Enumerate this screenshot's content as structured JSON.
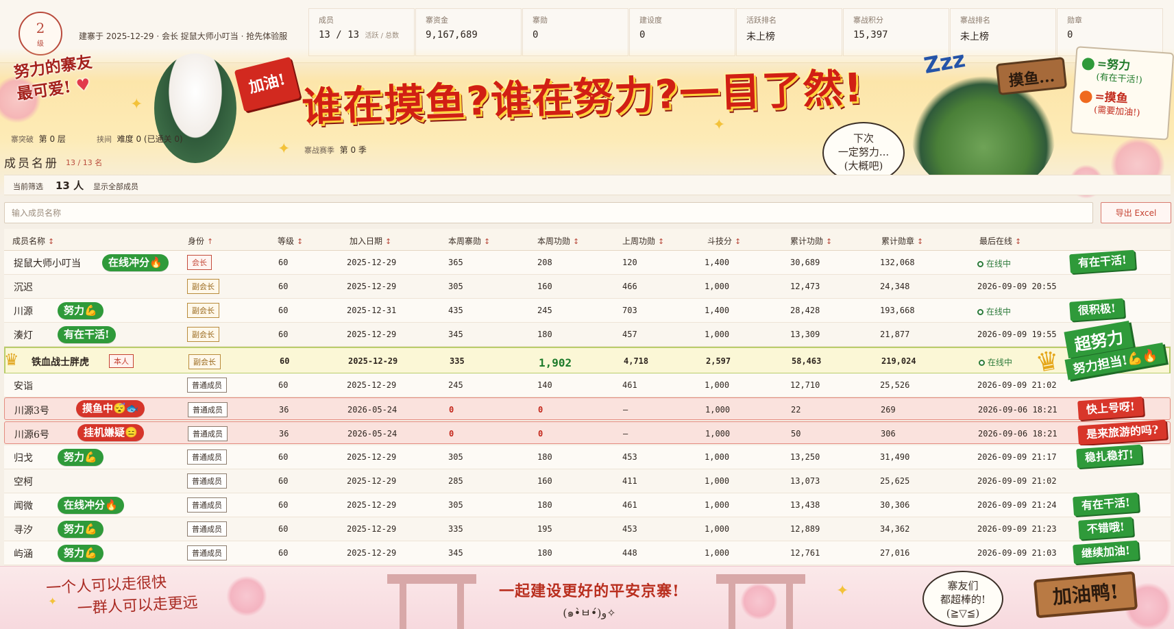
{
  "header": {
    "level": "2",
    "level_unit": "级",
    "founded": "建寨于 2025-12-29 · 会长 捉鼠大师小叮当 · 抢先体验服",
    "stats": [
      {
        "label": "成员",
        "value": "13 / 13",
        "sub": "活跃 / 总数"
      },
      {
        "label": "寨资金",
        "value": "9,167,689"
      },
      {
        "label": "寨勋",
        "value": "0"
      },
      {
        "label": "建设度",
        "value": "0"
      },
      {
        "label": "活跃排名",
        "value": "未上榜"
      },
      {
        "label": "寨战积分",
        "value": "15,397"
      },
      {
        "label": "寨战排名",
        "value": "未上榜"
      },
      {
        "label": "勋章",
        "value": "0"
      }
    ]
  },
  "banner": {
    "left_line1": "努力的寨友",
    "left_line2": "最可爱!",
    "flag_text": "加油!",
    "headline": "谁在摸鱼?谁在努力?一目了然!",
    "zzz": "Zzz",
    "speech_line1": "下次",
    "speech_line2": "一定努力...",
    "speech_line3": "(大概吧)",
    "signpost": "摸鱼...",
    "legend_green": "=努力",
    "legend_green_sub": "(有在干活!)",
    "legend_red": "=摸鱼",
    "legend_red_sub": "(需要加油!)"
  },
  "info": {
    "breakthrough_label": "寨突破",
    "breakthrough_value": "第 0 层",
    "challenge_label": "挟间",
    "challenge_value": "难度 0 (已通关 0)",
    "season_label": "寨战赛季",
    "season_value": "第 0 季"
  },
  "roster": {
    "title": "成员名册",
    "count": "13 / 13 名",
    "filter_label": "当前筛选",
    "filter_count": "13 人",
    "show_all": "显示全部成员",
    "search_placeholder": "输入成员名称",
    "export": "导出 Excel"
  },
  "table": {
    "columns": [
      "成员名称",
      "身份",
      "等级",
      "加入日期",
      "本周寨勋",
      "本周功勋",
      "上周功勋",
      "斗技分",
      "累计功勋",
      "累计勋章",
      "最后在线"
    ],
    "column_arrows": [
      "↕",
      "↑",
      "↕",
      "↕",
      "↕",
      "↕",
      "↕",
      "↕",
      "↕",
      "↕",
      "↕"
    ],
    "rows": [
      {
        "name": "捉鼠大师小叮当",
        "tag": "在线冲分🔥",
        "role": "会长",
        "level": "60",
        "join": "2025-12-29",
        "week_hon": "365",
        "week_merit": "208",
        "last_merit": "120",
        "duel": "1,400",
        "total_merit": "30,689",
        "total_medal": "132,068",
        "online": "在线中",
        "comment": "有在干活!"
      },
      {
        "name": "沉迟",
        "tag": "",
        "role": "副会长",
        "level": "60",
        "join": "2025-12-29",
        "week_hon": "305",
        "week_merit": "160",
        "last_merit": "466",
        "duel": "1,000",
        "total_merit": "12,473",
        "total_medal": "24,348",
        "online": "2026-09-09 20:55",
        "comment": ""
      },
      {
        "name": "川源",
        "tag": "努力💪",
        "role": "副会长",
        "level": "60",
        "join": "2025-12-31",
        "week_hon": "435",
        "week_merit": "245",
        "last_merit": "703",
        "duel": "1,400",
        "total_merit": "28,428",
        "total_medal": "193,668",
        "online": "在线中",
        "comment": "很积极!"
      },
      {
        "name": "湊灯",
        "tag": "有在干活!",
        "role": "副会长",
        "level": "60",
        "join": "2025-12-29",
        "week_hon": "345",
        "week_merit": "180",
        "last_merit": "457",
        "duel": "1,000",
        "total_merit": "13,309",
        "total_medal": "21,877",
        "online": "2026-09-09 19:55",
        "comment": ""
      },
      {
        "name": "铁血战士胖虎",
        "tag": "本人",
        "role": "副会长",
        "level": "60",
        "join": "2025-12-29",
        "week_hon": "335",
        "week_merit": "1,902",
        "last_merit": "4,718",
        "duel": "2,597",
        "total_merit": "58,463",
        "total_medal": "219,024",
        "online": "在线中",
        "comment": ""
      },
      {
        "name": "安诣",
        "tag": "",
        "role": "普通成员",
        "level": "60",
        "join": "2025-12-29",
        "week_hon": "245",
        "week_merit": "140",
        "last_merit": "461",
        "duel": "1,000",
        "total_merit": "12,710",
        "total_medal": "25,526",
        "online": "2026-09-09 21:02",
        "comment": ""
      },
      {
        "name": "川源3号",
        "tag": "摸鱼中😴🐟",
        "role": "普通成员",
        "level": "36",
        "join": "2026-05-24",
        "week_hon": "0",
        "week_merit": "0",
        "last_merit": "—",
        "duel": "1,000",
        "total_merit": "22",
        "total_medal": "269",
        "online": "2026-09-06 18:21",
        "comment": "快上号呀!"
      },
      {
        "name": "川源6号",
        "tag": "挂机嫌疑😑",
        "role": "普通成员",
        "level": "36",
        "join": "2026-05-24",
        "week_hon": "0",
        "week_merit": "0",
        "last_merit": "—",
        "duel": "1,000",
        "total_merit": "50",
        "total_medal": "306",
        "online": "2026-09-06 18:21",
        "comment": "是来旅游的吗?"
      },
      {
        "name": "归戈",
        "tag": "努力💪",
        "role": "普通成员",
        "level": "60",
        "join": "2025-12-29",
        "week_hon": "305",
        "week_merit": "180",
        "last_merit": "453",
        "duel": "1,000",
        "total_merit": "13,250",
        "total_medal": "31,490",
        "online": "2026-09-09 21:17",
        "comment": "稳扎稳打!"
      },
      {
        "name": "空柯",
        "tag": "",
        "role": "普通成员",
        "level": "60",
        "join": "2025-12-29",
        "week_hon": "285",
        "week_merit": "160",
        "last_merit": "411",
        "duel": "1,000",
        "total_merit": "13,073",
        "total_medal": "25,625",
        "online": "2026-09-09 21:02",
        "comment": ""
      },
      {
        "name": "闻微",
        "tag": "在线冲分🔥",
        "role": "普通成员",
        "level": "60",
        "join": "2025-12-29",
        "week_hon": "305",
        "week_merit": "180",
        "last_merit": "461",
        "duel": "1,000",
        "total_merit": "13,438",
        "total_medal": "30,306",
        "online": "2026-09-09 21:24",
        "comment": "有在干活!"
      },
      {
        "name": "寻汐",
        "tag": "努力💪",
        "role": "普通成员",
        "level": "60",
        "join": "2025-12-29",
        "week_hon": "335",
        "week_merit": "195",
        "last_merit": "453",
        "duel": "1,000",
        "total_merit": "12,889",
        "total_medal": "34,362",
        "online": "2026-09-09 21:23",
        "comment": "不错哦!"
      },
      {
        "name": "屿涵",
        "tag": "努力💪",
        "role": "普通成员",
        "level": "60",
        "join": "2025-12-29",
        "week_hon": "345",
        "week_merit": "180",
        "last_merit": "448",
        "duel": "1,000",
        "total_merit": "12,761",
        "total_medal": "27,016",
        "online": "2026-09-09 21:03",
        "comment": "继续加油!"
      }
    ],
    "super_line1": "超努力",
    "super_line2": "努力担当!💪🔥"
  },
  "footer": {
    "left_line1": "一个人可以走很快",
    "left_line2": "一群人可以走更远",
    "center_line1": "一起建设更好的平安京寨!",
    "center_line2": "(๑•̀ㅂ•́)و✧",
    "bubble_line1": "寨友们",
    "bubble_line2": "都超棒的!",
    "bubble_line3": "(≧▽≦)",
    "sign": "加油鸭!"
  },
  "colors": {
    "accent": "#b94a3c",
    "green": "#2f9a3a",
    "red": "#d6352a",
    "self_row": "#fbf7d6",
    "lazy_row": "#fae2dd"
  }
}
